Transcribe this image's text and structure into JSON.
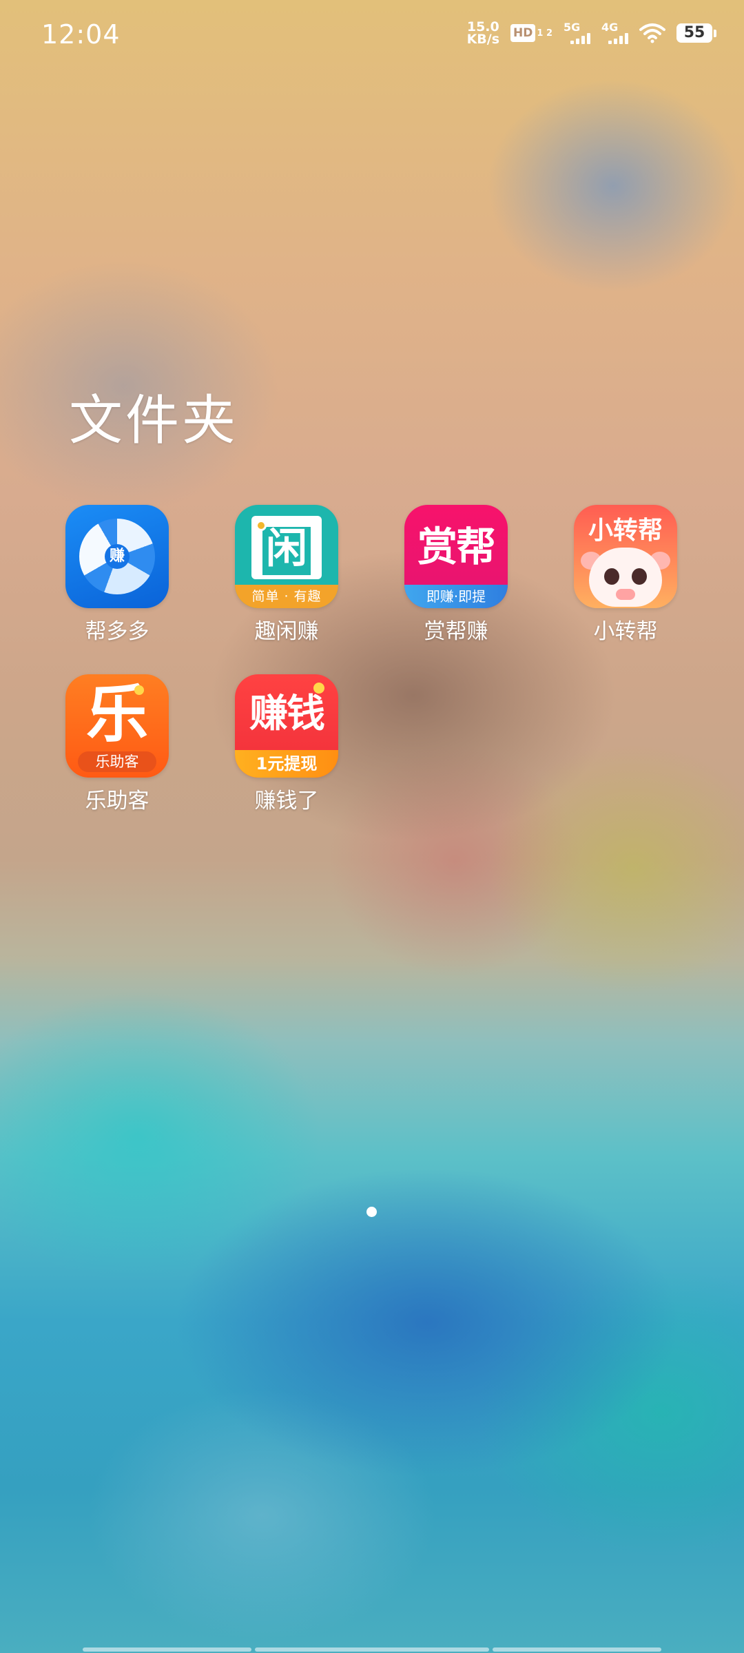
{
  "status_bar": {
    "time": "12:04",
    "net_speed_value": "15.0",
    "net_speed_unit": "KB/s",
    "hd_badge": "HD",
    "hd_sub": "1 2",
    "signal_1_label": "5G",
    "signal_2_label": "4G",
    "battery": "55",
    "icons": [
      "hd-voice-icon",
      "signal-5g-icon",
      "signal-4g-icon",
      "wifi-icon",
      "battery-icon"
    ]
  },
  "folder": {
    "title": "文件夹",
    "apps": [
      {
        "name": "帮多多",
        "icon": "bangduoduo-app-icon",
        "icon_text": "赚"
      },
      {
        "name": "趣闲赚",
        "icon": "quxianzhuan-app-icon",
        "icon_text": "闲",
        "icon_band": "简单 · 有趣"
      },
      {
        "name": "赏帮赚",
        "icon": "shangbangzhuan-app-icon",
        "icon_text": "赏帮",
        "icon_band": "即赚·即提"
      },
      {
        "name": "小转帮",
        "icon": "xiaozhuanbang-app-icon",
        "icon_text": "小转帮"
      },
      {
        "name": "乐助客",
        "icon": "lezhuke-app-icon",
        "icon_text": "乐",
        "icon_band": "乐助客"
      },
      {
        "name": "赚钱了",
        "icon": "zhuanqianle-app-icon",
        "icon_text": "赚钱",
        "icon_band": "1元提现"
      }
    ]
  },
  "page_indicator": {
    "pages": 1,
    "current": 1
  },
  "colors": {
    "bangduoduo": "#0a63d8",
    "quxian": "#1db6ad",
    "shangbang": "#e51471",
    "xiaozhuan": "#ff8a5a",
    "lezhuke": "#ff5a14",
    "zhuanqian": "#f02f3a"
  }
}
